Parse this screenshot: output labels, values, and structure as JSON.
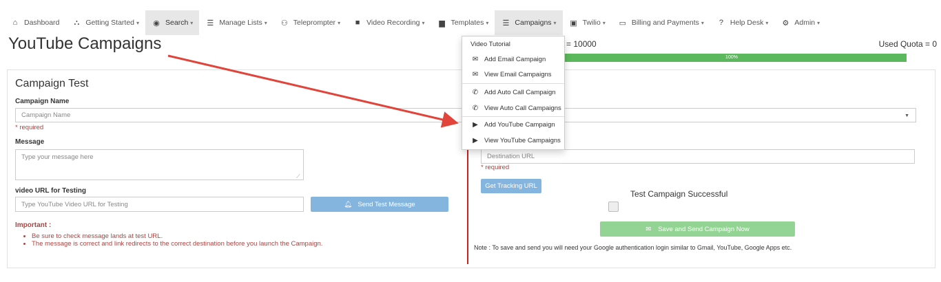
{
  "nav": {
    "items": [
      {
        "label": "Dashboard",
        "icon": "home-icon",
        "glyph": "⌂",
        "dropdown": false,
        "active": false
      },
      {
        "label": "Getting Started",
        "icon": "sitemap-icon",
        "glyph": "⛬",
        "dropdown": true,
        "active": false
      },
      {
        "label": "Search",
        "icon": "globe-icon",
        "glyph": "◉",
        "dropdown": true,
        "active": true
      },
      {
        "label": "Manage Lists",
        "icon": "list-icon",
        "glyph": "☰",
        "dropdown": true,
        "active": false
      },
      {
        "label": "Teleprompter",
        "icon": "binoculars-icon",
        "glyph": "⚇",
        "dropdown": true,
        "active": false
      },
      {
        "label": "Video Recording",
        "icon": "video-camera-icon",
        "glyph": "■",
        "dropdown": true,
        "active": false
      },
      {
        "label": "Templates",
        "icon": "file-icon",
        "glyph": "▆",
        "dropdown": true,
        "active": false
      },
      {
        "label": "Campaigns",
        "icon": "list-icon",
        "glyph": "☰",
        "dropdown": true,
        "active": true
      },
      {
        "label": "Twilio",
        "icon": "suitcase-icon",
        "glyph": "▣",
        "dropdown": true,
        "active": false
      },
      {
        "label": "Billing and Payments",
        "icon": "credit-card-icon",
        "glyph": "▭",
        "dropdown": true,
        "active": false
      },
      {
        "label": "Help Desk",
        "icon": "question-circle-icon",
        "glyph": "?",
        "dropdown": true,
        "active": false
      },
      {
        "label": "Admin",
        "icon": "cogs-icon",
        "glyph": "⚙",
        "dropdown": true,
        "active": false
      }
    ]
  },
  "page": {
    "title": "YouTube Campaigns",
    "quota_label": "= 10000",
    "used_quota_label": "Used Quota = 0",
    "progress_text": "100%",
    "progress_percent": 100
  },
  "form": {
    "heading": "Campaign Test",
    "campaign_name_label": "Campaign Name",
    "campaign_name_placeholder": "Campaign Name",
    "required_text": "* required",
    "message_label": "Message",
    "message_placeholder": "Type your message here",
    "video_url_label": "video URL for Testing",
    "video_url_placeholder": "Type YouTube Video URL for Testing",
    "send_test_button": "Send Test Message",
    "important_label": "Important :",
    "important_items": [
      "Be sure to check message lands at test URL.",
      "The message is correct and link redirects to the correct destination before you launch the Campaign."
    ]
  },
  "right": {
    "destination_placeholder": "Destination URL",
    "required_text": "* required",
    "tracking_button": "Get Tracking URL",
    "test_success_label": "Test Campaign Successful",
    "save_send_button": "Save and Send Campaign Now",
    "note": "Note : To save and send you will need your Google authentication login similar to Gmail, YouTube, Google Apps etc."
  },
  "dropdown": {
    "items": [
      {
        "label": "Video Tutorial",
        "icon": "",
        "glyph": ""
      },
      {
        "label": "Add Email Campaign",
        "icon": "envelope-icon",
        "glyph": "✉"
      },
      {
        "label": "View Email Campaigns",
        "icon": "envelope-icon",
        "glyph": "✉"
      },
      {
        "label": "Add Auto Call Campaign",
        "icon": "phone-icon",
        "glyph": "✆"
      },
      {
        "label": "View Auto Call Campaigns",
        "icon": "phone-icon",
        "glyph": "✆"
      },
      {
        "label": "Add YouTube Campaign",
        "icon": "youtube-icon",
        "glyph": "▶"
      },
      {
        "label": "View YouTube Campaigns",
        "icon": "youtube-icon",
        "glyph": "▶"
      }
    ]
  },
  "colors": {
    "progress": "#5cb85c",
    "required": "#a94442",
    "button_blue": "#84b5df",
    "button_green": "#93d393",
    "arrow": "#e0443b"
  }
}
